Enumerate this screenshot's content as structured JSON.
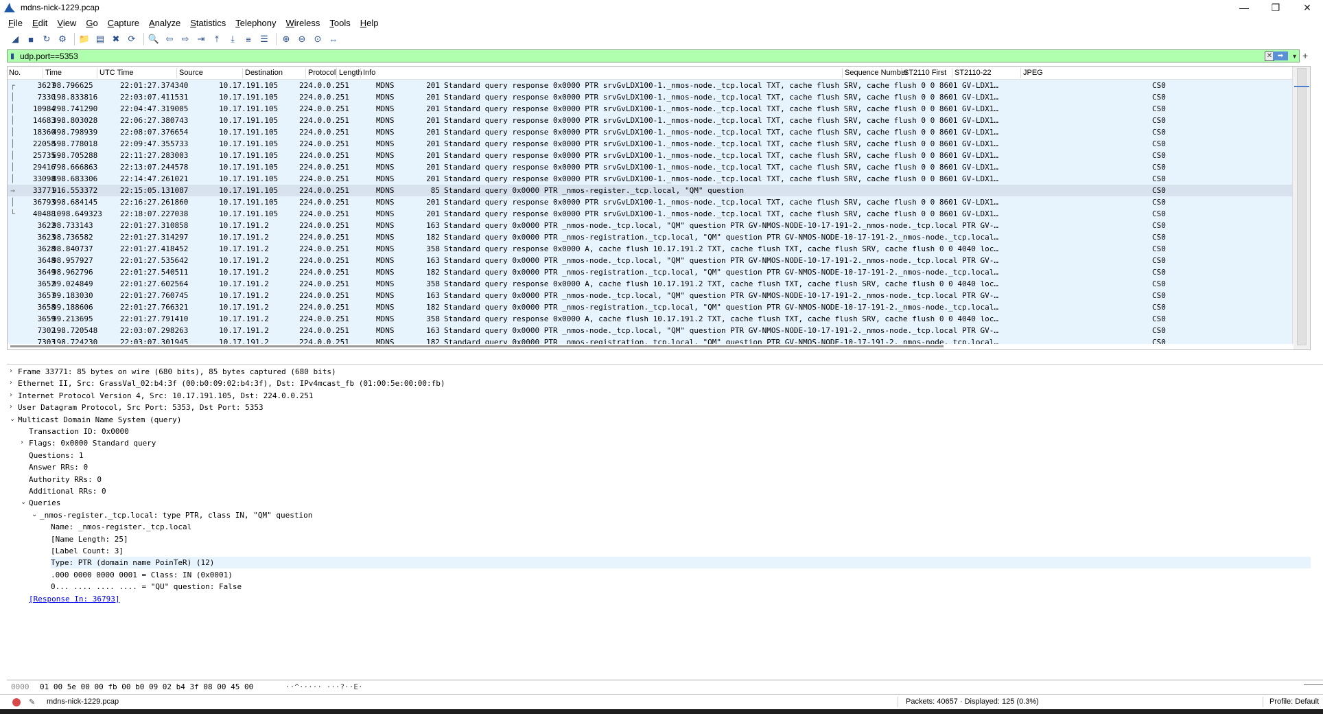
{
  "window": {
    "title": "mdns-nick-1229.pcap",
    "minimize": "—",
    "maximize": "❐",
    "close": "✕"
  },
  "menu": [
    "File",
    "Edit",
    "View",
    "Go",
    "Capture",
    "Analyze",
    "Statistics",
    "Telephony",
    "Wireless",
    "Tools",
    "Help"
  ],
  "toolbar_icons": [
    "start-capture-icon",
    "stop-capture-icon",
    "restart-capture-icon",
    "capture-options-icon",
    "open-file-icon",
    "save-file-icon",
    "close-file-icon",
    "reload-file-icon",
    "find-packet-icon",
    "go-back-icon",
    "go-forward-icon",
    "go-to-packet-icon",
    "go-first-icon",
    "go-last-icon",
    "autoscroll-icon",
    "colorize-icon",
    "zoom-in-icon",
    "zoom-out-icon",
    "normal-size-icon",
    "resize-columns-icon"
  ],
  "filter": {
    "value": "udp.port==5353",
    "clear": "✕",
    "apply": "➡",
    "add": "+"
  },
  "columns": [
    "No.",
    "Time",
    "UTC Time",
    "Source",
    "Destination",
    "Protocol",
    "Length",
    "Info",
    "Sequence Number",
    "ST2110 First",
    "ST2110-22",
    "JPEG"
  ],
  "packets": [
    {
      "rel": "┌",
      "no": "3627",
      "time": "98.796625",
      "utc": "22:01:27.374340",
      "src": "10.17.191.105",
      "dst": "224.0.0.251",
      "proto": "MDNS",
      "len": "201",
      "info": "Standard query response 0x0000 PTR srvGvLDX100-1._nmos-node._tcp.local TXT, cache flush SRV, cache flush 0 0 8601 GV-LDX1…",
      "st": "CS0"
    },
    {
      "rel": "│",
      "no": "7330",
      "time": "198.833816",
      "utc": "22:03:07.411531",
      "src": "10.17.191.105",
      "dst": "224.0.0.251",
      "proto": "MDNS",
      "len": "201",
      "info": "Standard query response 0x0000 PTR srvGvLDX100-1._nmos-node._tcp.local TXT, cache flush SRV, cache flush 0 0 8601 GV-LDX1…",
      "st": "CS0"
    },
    {
      "rel": "│",
      "no": "10984",
      "time": "298.741290",
      "utc": "22:04:47.319005",
      "src": "10.17.191.105",
      "dst": "224.0.0.251",
      "proto": "MDNS",
      "len": "201",
      "info": "Standard query response 0x0000 PTR srvGvLDX100-1._nmos-node._tcp.local TXT, cache flush SRV, cache flush 0 0 8601 GV-LDX1…",
      "st": "CS0"
    },
    {
      "rel": "│",
      "no": "14683",
      "time": "398.803028",
      "utc": "22:06:27.380743",
      "src": "10.17.191.105",
      "dst": "224.0.0.251",
      "proto": "MDNS",
      "len": "201",
      "info": "Standard query response 0x0000 PTR srvGvLDX100-1._nmos-node._tcp.local TXT, cache flush SRV, cache flush 0 0 8601 GV-LDX1…",
      "st": "CS0"
    },
    {
      "rel": "│",
      "no": "18360",
      "time": "498.798939",
      "utc": "22:08:07.376654",
      "src": "10.17.191.105",
      "dst": "224.0.0.251",
      "proto": "MDNS",
      "len": "201",
      "info": "Standard query response 0x0000 PTR srvGvLDX100-1._nmos-node._tcp.local TXT, cache flush SRV, cache flush 0 0 8601 GV-LDX1…",
      "st": "CS0"
    },
    {
      "rel": "│",
      "no": "22058",
      "time": "598.778018",
      "utc": "22:09:47.355733",
      "src": "10.17.191.105",
      "dst": "224.0.0.251",
      "proto": "MDNS",
      "len": "201",
      "info": "Standard query response 0x0000 PTR srvGvLDX100-1._nmos-node._tcp.local TXT, cache flush SRV, cache flush 0 0 8601 GV-LDX1…",
      "st": "CS0"
    },
    {
      "rel": "│",
      "no": "25735",
      "time": "698.705288",
      "utc": "22:11:27.283003",
      "src": "10.17.191.105",
      "dst": "224.0.0.251",
      "proto": "MDNS",
      "len": "201",
      "info": "Standard query response 0x0000 PTR srvGvLDX100-1._nmos-node._tcp.local TXT, cache flush SRV, cache flush 0 0 8601 GV-LDX1…",
      "st": "CS0"
    },
    {
      "rel": "│",
      "no": "29416",
      "time": "798.666863",
      "utc": "22:13:07.244578",
      "src": "10.17.191.105",
      "dst": "224.0.0.251",
      "proto": "MDNS",
      "len": "201",
      "info": "Standard query response 0x0000 PTR srvGvLDX100-1._nmos-node._tcp.local TXT, cache flush SRV, cache flush 0 0 8601 GV-LDX1…",
      "st": "CS0"
    },
    {
      "rel": "│",
      "no": "33098",
      "time": "898.683306",
      "utc": "22:14:47.261021",
      "src": "10.17.191.105",
      "dst": "224.0.0.251",
      "proto": "MDNS",
      "len": "201",
      "info": "Standard query response 0x0000 PTR srvGvLDX100-1._nmos-node._tcp.local TXT, cache flush SRV, cache flush 0 0 8601 GV-LDX1…",
      "st": "CS0"
    },
    {
      "rel": "→",
      "no": "33771",
      "time": "916.553372",
      "utc": "22:15:05.131087",
      "src": "10.17.191.105",
      "dst": "224.0.0.251",
      "proto": "MDNS",
      "len": "85",
      "info": "Standard query 0x0000 PTR _nmos-register._tcp.local, \"QM\" question",
      "st": "CS0",
      "selected": true
    },
    {
      "rel": "│",
      "no": "36793",
      "time": "998.684145",
      "utc": "22:16:27.261860",
      "src": "10.17.191.105",
      "dst": "224.0.0.251",
      "proto": "MDNS",
      "len": "201",
      "info": "Standard query response 0x0000 PTR srvGvLDX100-1._nmos-node._tcp.local TXT, cache flush SRV, cache flush 0 0 8601 GV-LDX1…",
      "st": "CS0"
    },
    {
      "rel": "└",
      "no": "40488",
      "time": "1098.649323",
      "utc": "22:18:07.227038",
      "src": "10.17.191.105",
      "dst": "224.0.0.251",
      "proto": "MDNS",
      "len": "201",
      "info": "Standard query response 0x0000 PTR srvGvLDX100-1._nmos-node._tcp.local TXT, cache flush SRV, cache flush 0 0 8601 GV-LDX1…",
      "st": "CS0"
    },
    {
      "rel": "",
      "no": "3622",
      "time": "98.733143",
      "utc": "22:01:27.310858",
      "src": "10.17.191.2",
      "dst": "224.0.0.251",
      "proto": "MDNS",
      "len": "163",
      "info": "Standard query 0x0000 PTR _nmos-node._tcp.local, \"QM\" question PTR GV-NMOS-NODE-10-17-191-2._nmos-node._tcp.local PTR GV-…",
      "st": "CS0"
    },
    {
      "rel": "",
      "no": "3623",
      "time": "98.736582",
      "utc": "22:01:27.314297",
      "src": "10.17.191.2",
      "dst": "224.0.0.251",
      "proto": "MDNS",
      "len": "182",
      "info": "Standard query 0x0000 PTR _nmos-registration._tcp.local, \"QM\" question PTR GV-NMOS-NODE-10-17-191-2._nmos-node._tcp.local…",
      "st": "CS0"
    },
    {
      "rel": "",
      "no": "3628",
      "time": "98.840737",
      "utc": "22:01:27.418452",
      "src": "10.17.191.2",
      "dst": "224.0.0.251",
      "proto": "MDNS",
      "len": "358",
      "info": "Standard query response 0x0000 A, cache flush 10.17.191.2 TXT, cache flush TXT, cache flush SRV, cache flush 0 0 4040 loc…",
      "st": "CS0"
    },
    {
      "rel": "",
      "no": "3648",
      "time": "98.957927",
      "utc": "22:01:27.535642",
      "src": "10.17.191.2",
      "dst": "224.0.0.251",
      "proto": "MDNS",
      "len": "163",
      "info": "Standard query 0x0000 PTR _nmos-node._tcp.local, \"QM\" question PTR GV-NMOS-NODE-10-17-191-2._nmos-node._tcp.local PTR GV-…",
      "st": "CS0"
    },
    {
      "rel": "",
      "no": "3649",
      "time": "98.962796",
      "utc": "22:01:27.540511",
      "src": "10.17.191.2",
      "dst": "224.0.0.251",
      "proto": "MDNS",
      "len": "182",
      "info": "Standard query 0x0000 PTR _nmos-registration._tcp.local, \"QM\" question PTR GV-NMOS-NODE-10-17-191-2._nmos-node._tcp.local…",
      "st": "CS0"
    },
    {
      "rel": "",
      "no": "3652",
      "time": "99.024849",
      "utc": "22:01:27.602564",
      "src": "10.17.191.2",
      "dst": "224.0.0.251",
      "proto": "MDNS",
      "len": "358",
      "info": "Standard query response 0x0000 A, cache flush 10.17.191.2 TXT, cache flush TXT, cache flush SRV, cache flush 0 0 4040 loc…",
      "st": "CS0"
    },
    {
      "rel": "",
      "no": "3657",
      "time": "99.183030",
      "utc": "22:01:27.760745",
      "src": "10.17.191.2",
      "dst": "224.0.0.251",
      "proto": "MDNS",
      "len": "163",
      "info": "Standard query 0x0000 PTR _nmos-node._tcp.local, \"QM\" question PTR GV-NMOS-NODE-10-17-191-2._nmos-node._tcp.local PTR GV-…",
      "st": "CS0"
    },
    {
      "rel": "",
      "no": "3658",
      "time": "99.188606",
      "utc": "22:01:27.766321",
      "src": "10.17.191.2",
      "dst": "224.0.0.251",
      "proto": "MDNS",
      "len": "182",
      "info": "Standard query 0x0000 PTR _nmos-registration._tcp.local, \"QM\" question PTR GV-NMOS-NODE-10-17-191-2._nmos-node._tcp.local…",
      "st": "CS0"
    },
    {
      "rel": "",
      "no": "3659",
      "time": "99.213695",
      "utc": "22:01:27.791410",
      "src": "10.17.191.2",
      "dst": "224.0.0.251",
      "proto": "MDNS",
      "len": "358",
      "info": "Standard query response 0x0000 A, cache flush 10.17.191.2 TXT, cache flush TXT, cache flush SRV, cache flush 0 0 4040 loc…",
      "st": "CS0"
    },
    {
      "rel": "",
      "no": "7302",
      "time": "198.720548",
      "utc": "22:03:07.298263",
      "src": "10.17.191.2",
      "dst": "224.0.0.251",
      "proto": "MDNS",
      "len": "163",
      "info": "Standard query 0x0000 PTR _nmos-node._tcp.local, \"QM\" question PTR GV-NMOS-NODE-10-17-191-2._nmos-node._tcp.local PTR GV-…",
      "st": "CS0"
    },
    {
      "rel": "",
      "no": "7303",
      "time": "198.724230",
      "utc": "22:03:07.301945",
      "src": "10.17.191.2",
      "dst": "224.0.0.251",
      "proto": "MDNS",
      "len": "182",
      "info": "Standard query 0x0000 PTR _nmos-registration._tcp.local, \"QM\" question PTR GV-NMOS-NODE-10-17-191-2._nmos-node._tcp.local…",
      "st": "CS0"
    }
  ],
  "details": [
    {
      "arrow": "›",
      "indent": 0,
      "text": "Frame 33771: 85 bytes on wire (680 bits), 85 bytes captured (680 bits)"
    },
    {
      "arrow": "›",
      "indent": 0,
      "text": "Ethernet II, Src: GrassVal_02:b4:3f (00:b0:09:02:b4:3f), Dst: IPv4mcast_fb (01:00:5e:00:00:fb)"
    },
    {
      "arrow": "›",
      "indent": 0,
      "text": "Internet Protocol Version 4, Src: 10.17.191.105, Dst: 224.0.0.251"
    },
    {
      "arrow": "›",
      "indent": 0,
      "text": "User Datagram Protocol, Src Port: 5353, Dst Port: 5353"
    },
    {
      "arrow": "⌄",
      "indent": 0,
      "text": "Multicast Domain Name System (query)"
    },
    {
      "arrow": "",
      "indent": 1,
      "text": "Transaction ID: 0x0000"
    },
    {
      "arrow": "›",
      "indent": 1,
      "text": "Flags: 0x0000 Standard query"
    },
    {
      "arrow": "",
      "indent": 1,
      "text": "Questions: 1"
    },
    {
      "arrow": "",
      "indent": 1,
      "text": "Answer RRs: 0"
    },
    {
      "arrow": "",
      "indent": 1,
      "text": "Authority RRs: 0"
    },
    {
      "arrow": "",
      "indent": 1,
      "text": "Additional RRs: 0"
    },
    {
      "arrow": "⌄",
      "indent": 1,
      "text": "Queries"
    },
    {
      "arrow": "⌄",
      "indent": 2,
      "text": "_nmos-register._tcp.local: type PTR, class IN, \"QM\" question"
    },
    {
      "arrow": "",
      "indent": 3,
      "text": "Name: _nmos-register._tcp.local"
    },
    {
      "arrow": "",
      "indent": 3,
      "text": "[Name Length: 25]"
    },
    {
      "arrow": "",
      "indent": 3,
      "text": "[Label Count: 3]"
    },
    {
      "arrow": "",
      "indent": 3,
      "text": "Type: PTR (domain name PoinTeR) (12)",
      "highlight": true
    },
    {
      "arrow": "",
      "indent": 3,
      "text": ".000 0000 0000 0001 = Class: IN (0x0001)"
    },
    {
      "arrow": "",
      "indent": 3,
      "text": "0... .... .... .... = \"QU\" question: False"
    },
    {
      "arrow": "",
      "indent": 1,
      "text": "[Response In: 36793]",
      "link": true
    }
  ],
  "hex": {
    "offset": "0000",
    "bytes": "01 00 5e 00 00 fb 00 b0  09 02 b4 3f 08 00 45 00",
    "ascii": "··^·····  ···?··E·"
  },
  "status": {
    "file": "mdns-nick-1229.pcap",
    "packets": "Packets: 40657 · Displayed: 125 (0.3%)",
    "profile": "Profile: Default"
  }
}
